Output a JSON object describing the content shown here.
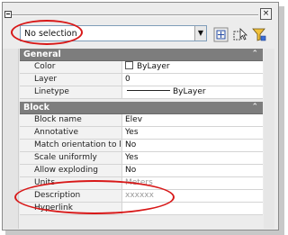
{
  "window": {
    "close_glyph": "×"
  },
  "selector": {
    "value": "No selection",
    "arrow_glyph": "▼"
  },
  "toolbar": {
    "icons": [
      "toggle-pickadd-icon",
      "select-objects-icon",
      "quick-select-icon"
    ]
  },
  "categories": {
    "general": {
      "title": "General",
      "rows": [
        {
          "label": "Color",
          "value": "ByLayer"
        },
        {
          "label": "Layer",
          "value": "0"
        },
        {
          "label": "Linetype",
          "value": "ByLayer"
        }
      ]
    },
    "block": {
      "title": "Block",
      "rows": [
        {
          "label": "Block name",
          "value": "Elev"
        },
        {
          "label": "Annotative",
          "value": "Yes"
        },
        {
          "label": "Match orientation to l...",
          "value": "No"
        },
        {
          "label": "Scale uniformly",
          "value": "Yes"
        },
        {
          "label": "Allow exploding",
          "value": "No"
        },
        {
          "label": "Units",
          "value": "Meters"
        },
        {
          "label": "Description",
          "value": "xxxxxx"
        },
        {
          "label": "Hyperlink",
          "value": ""
        }
      ]
    },
    "collapse_glyph": "⌃"
  },
  "colors": {
    "category_header": "#7d7d7d",
    "highlight": "#d81818",
    "panel": "#ececec"
  }
}
